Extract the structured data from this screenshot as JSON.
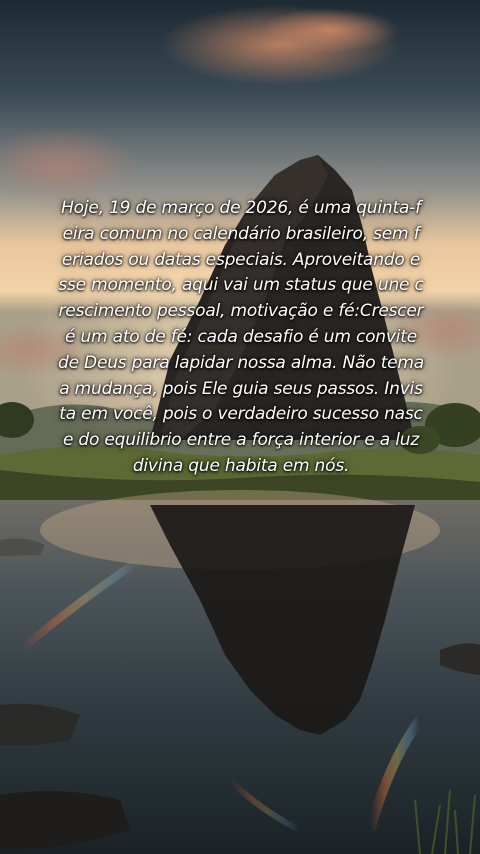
{
  "status": {
    "text": "Hoje, 19 de março de 2026, é uma quinta-feira comum no calendário brasileiro, sem feriados ou datas especiais. Aproveitando esse momento, aqui vai um status que une crescimento pessoal, motivação e fé:Crescer é um ato de fé: cada desafio é um convite de Deus para lapidar nossa alma. Não tema a mudança, pois Ele guia seus passos. Invista em você, pois o verdadeiro sucesso nasce do equilibrio entre a força interior e a luz divina que habita em nós."
  },
  "colors": {
    "text": "#ffffff",
    "sky_top": "#2a3a44",
    "sky_glow": "#f3c89a",
    "water": "#3a4a52",
    "rock": "#1f1c1a",
    "grass": "#5c6a34"
  }
}
